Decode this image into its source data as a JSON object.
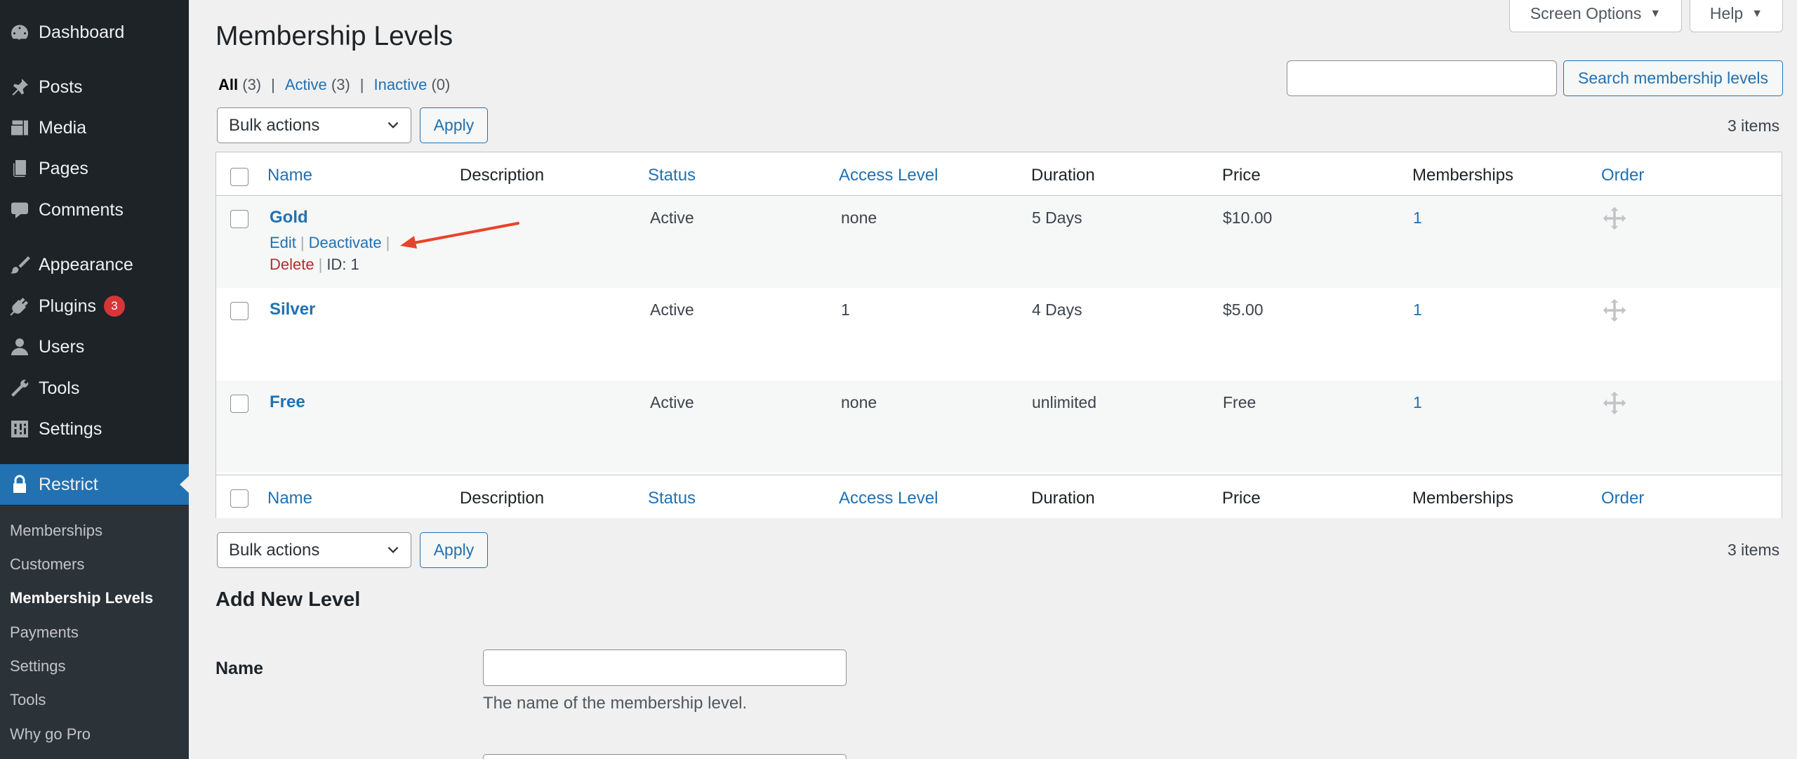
{
  "sidebar": {
    "items": [
      {
        "label": "Dashboard",
        "icon": "dashboard-icon"
      },
      {
        "label": "Posts",
        "icon": "pushpin-icon"
      },
      {
        "label": "Media",
        "icon": "media-icon"
      },
      {
        "label": "Pages",
        "icon": "pages-icon"
      },
      {
        "label": "Comments",
        "icon": "comment-icon"
      },
      {
        "label": "Appearance",
        "icon": "paintbrush-icon"
      },
      {
        "label": "Plugins",
        "icon": "plugin-icon",
        "badge": "3"
      },
      {
        "label": "Users",
        "icon": "user-icon"
      },
      {
        "label": "Tools",
        "icon": "wrench-icon"
      },
      {
        "label": "Settings",
        "icon": "settings-icon"
      },
      {
        "label": "Restrict",
        "icon": "lock-icon"
      }
    ],
    "submenu": [
      "Memberships",
      "Customers",
      "Membership Levels",
      "Payments",
      "Settings",
      "Tools",
      "Why go Pro"
    ]
  },
  "top": {
    "screen_options": "Screen Options",
    "help": "Help"
  },
  "page": {
    "title": "Membership Levels",
    "views": {
      "all": "All",
      "all_count": "(3)",
      "active": "Active",
      "active_count": "(3)",
      "inactive": "Inactive",
      "inactive_count": "(0)",
      "sep": "|"
    },
    "search_button": "Search membership levels",
    "bulk_actions": "Bulk actions",
    "apply": "Apply",
    "items_count": "3 items"
  },
  "table": {
    "columns": [
      "Name",
      "Description",
      "Status",
      "Access Level",
      "Duration",
      "Price",
      "Memberships",
      "Order"
    ],
    "rows": [
      {
        "name": "Gold",
        "description": "",
        "status": "Active",
        "access": "none",
        "duration": "5 Days",
        "price": "$10.00",
        "memberships": "1"
      },
      {
        "name": "Silver",
        "description": "",
        "status": "Active",
        "access": "1",
        "duration": "4 Days",
        "price": "$5.00",
        "memberships": "1"
      },
      {
        "name": "Free",
        "description": "",
        "status": "Active",
        "access": "none",
        "duration": "unlimited",
        "price": "Free",
        "memberships": "1"
      }
    ],
    "row_actions": {
      "edit": "Edit",
      "deactivate": "Deactivate",
      "delete": "Delete",
      "id": "ID: 1",
      "pipe": "|"
    }
  },
  "add_new": {
    "title": "Add New Level",
    "name_label": "Name",
    "name_desc": "The name of the membership level."
  },
  "colors": {
    "accent": "#2271b1",
    "sidebar": "#1d2327",
    "annotation": "#e8442a",
    "danger": "#b32d2e"
  }
}
